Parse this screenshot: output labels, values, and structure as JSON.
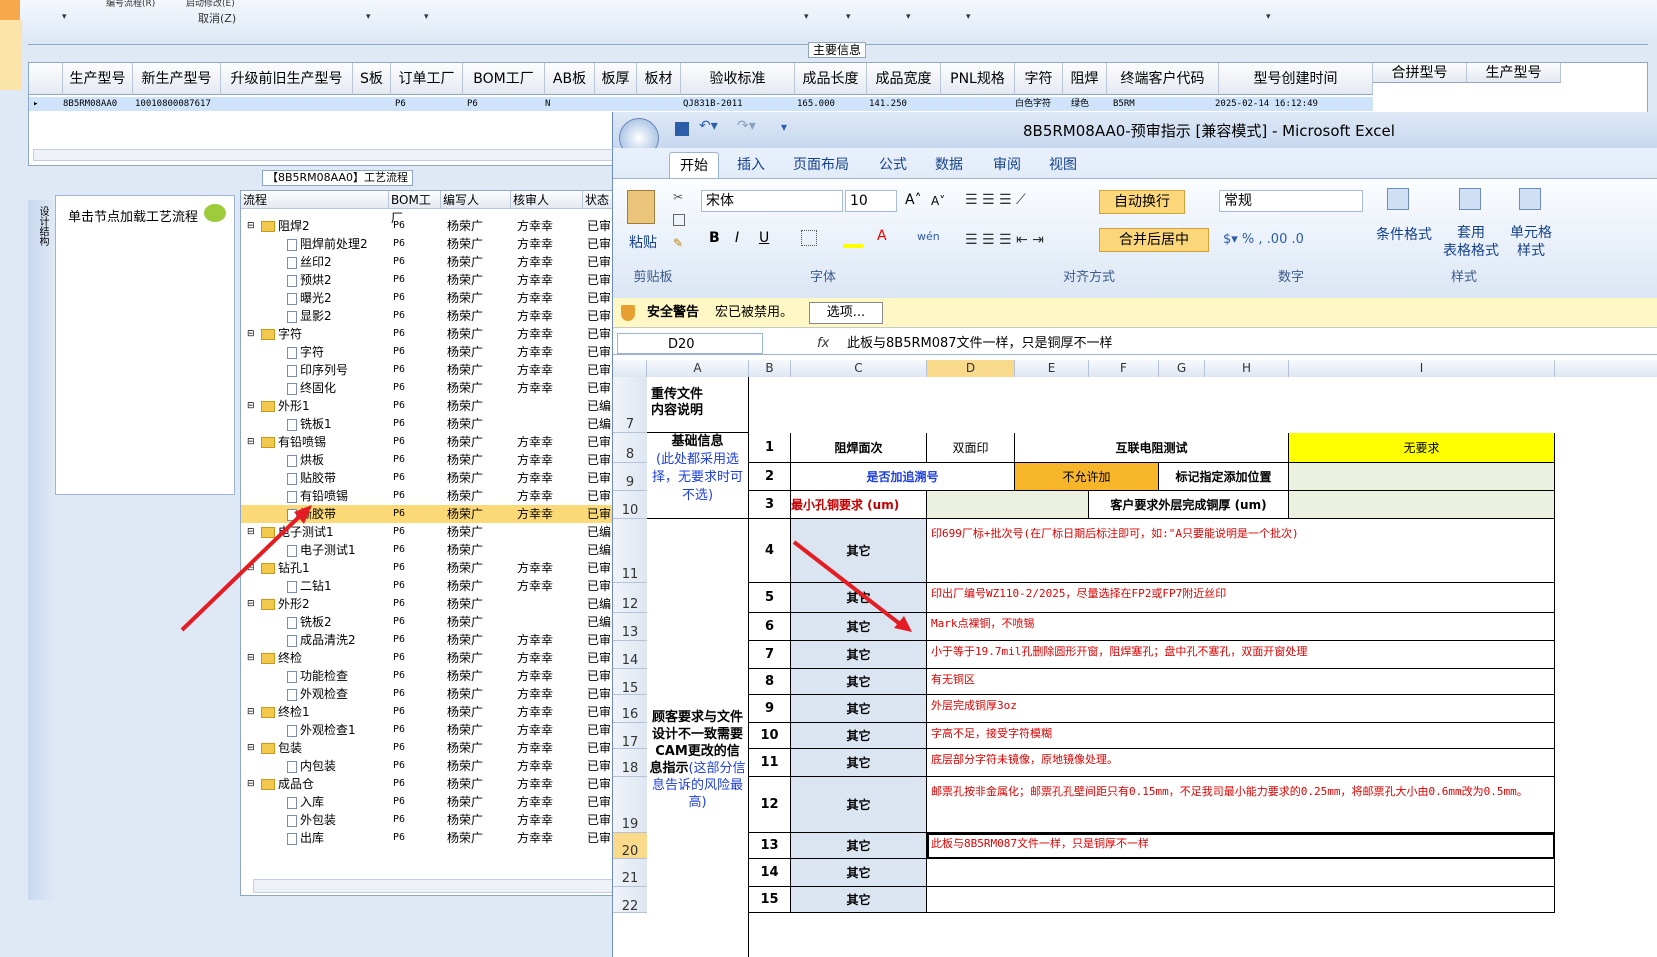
{
  "toolbar": {
    "item1": "编号流程(R)",
    "item2": "启动修改(E)",
    "cancel": "取消(Z)"
  },
  "main_info": {
    "title": "主要信息",
    "columns": [
      "生产型号",
      "新生产型号",
      "升级前旧生产型号",
      "S板",
      "订单工厂",
      "BOM工厂",
      "AB板",
      "板厚",
      "板材",
      "验收标准",
      "成品长度",
      "成品宽度",
      "PNL规格",
      "字符",
      "阻焊",
      "终端客户代码",
      "型号创建时间"
    ],
    "extra_columns": [
      "合拼型号",
      "生产型号"
    ],
    "row": [
      "8B5RM08AA0",
      "10010800087617",
      "",
      "",
      "P6",
      "",
      "P6",
      "",
      "N",
      "",
      "QJ831B-2011",
      "165.000",
      "141.250",
      "",
      "白色字符",
      "绿色",
      "B5RM",
      "2025-02-14 16:12:49"
    ]
  },
  "process": {
    "title": "【8B5RM08AA0】工艺流程",
    "left_tab": "设计结构",
    "load_hint": "单击节点加载工艺流程",
    "headers": [
      "流程",
      "BOM工厂",
      "编写人",
      "核审人",
      "状态"
    ],
    "rows": [
      {
        "name": "阻焊2",
        "type": "folder",
        "level": 1,
        "bom": "P6",
        "writer": "杨荣广",
        "reviewer": "方幸幸",
        "status": "已审"
      },
      {
        "name": "阻焊前处理2",
        "type": "file",
        "level": 2,
        "bom": "P6",
        "writer": "杨荣广",
        "reviewer": "方幸幸",
        "status": "已审"
      },
      {
        "name": "丝印2",
        "type": "file",
        "level": 2,
        "bom": "P6",
        "writer": "杨荣广",
        "reviewer": "方幸幸",
        "status": "已审"
      },
      {
        "name": "预烘2",
        "type": "file",
        "level": 2,
        "bom": "P6",
        "writer": "杨荣广",
        "reviewer": "方幸幸",
        "status": "已审"
      },
      {
        "name": "曝光2",
        "type": "file",
        "level": 2,
        "bom": "P6",
        "writer": "杨荣广",
        "reviewer": "方幸幸",
        "status": "已审"
      },
      {
        "name": "显影2",
        "type": "file",
        "level": 2,
        "bom": "P6",
        "writer": "杨荣广",
        "reviewer": "方幸幸",
        "status": "已审"
      },
      {
        "name": "字符",
        "type": "folder",
        "level": 1,
        "bom": "P6",
        "writer": "杨荣广",
        "reviewer": "方幸幸",
        "status": "已审"
      },
      {
        "name": "字符",
        "type": "file",
        "level": 2,
        "bom": "P6",
        "writer": "杨荣广",
        "reviewer": "方幸幸",
        "status": "已审"
      },
      {
        "name": "印序列号",
        "type": "file",
        "level": 2,
        "bom": "P6",
        "writer": "杨荣广",
        "reviewer": "方幸幸",
        "status": "已审"
      },
      {
        "name": "终固化",
        "type": "file",
        "level": 2,
        "bom": "P6",
        "writer": "杨荣广",
        "reviewer": "方幸幸",
        "status": "已审"
      },
      {
        "name": "外形1",
        "type": "folder",
        "level": 1,
        "bom": "P6",
        "writer": "杨荣广",
        "reviewer": "",
        "status": "已编"
      },
      {
        "name": "铣板1",
        "type": "file",
        "level": 2,
        "bom": "P6",
        "writer": "杨荣广",
        "reviewer": "",
        "status": "已编"
      },
      {
        "name": "有铅喷锡",
        "type": "folder",
        "level": 1,
        "bom": "P6",
        "writer": "杨荣广",
        "reviewer": "方幸幸",
        "status": "已审"
      },
      {
        "name": "烘板",
        "type": "file",
        "level": 2,
        "bom": "P6",
        "writer": "杨荣广",
        "reviewer": "方幸幸",
        "status": "已审"
      },
      {
        "name": "贴胶带",
        "type": "file",
        "level": 2,
        "bom": "P6",
        "writer": "杨荣广",
        "reviewer": "方幸幸",
        "status": "已审"
      },
      {
        "name": "有铅喷锡",
        "type": "file",
        "level": 2,
        "bom": "P6",
        "writer": "杨荣广",
        "reviewer": "方幸幸",
        "status": "已审"
      },
      {
        "name": "撕胶带",
        "type": "file",
        "level": 2,
        "bom": "P6",
        "writer": "杨荣广",
        "reviewer": "方幸幸",
        "status": "已审",
        "selected": true
      },
      {
        "name": "电子测试1",
        "type": "folder",
        "level": 1,
        "bom": "P6",
        "writer": "杨荣广",
        "reviewer": "",
        "status": "已编"
      },
      {
        "name": "电子测试1",
        "type": "file",
        "level": 2,
        "bom": "P6",
        "writer": "杨荣广",
        "reviewer": "",
        "status": "已编"
      },
      {
        "name": "钻孔1",
        "type": "folder",
        "level": 1,
        "bom": "P6",
        "writer": "杨荣广",
        "reviewer": "方幸幸",
        "status": "已审"
      },
      {
        "name": "二钻1",
        "type": "file",
        "level": 2,
        "bom": "P6",
        "writer": "杨荣广",
        "reviewer": "方幸幸",
        "status": "已审"
      },
      {
        "name": "外形2",
        "type": "folder",
        "level": 1,
        "bom": "P6",
        "writer": "杨荣广",
        "reviewer": "",
        "status": "已编"
      },
      {
        "name": "铣板2",
        "type": "file",
        "level": 2,
        "bom": "P6",
        "writer": "杨荣广",
        "reviewer": "",
        "status": "已编"
      },
      {
        "name": "成品清洗2",
        "type": "file",
        "level": 2,
        "bom": "P6",
        "writer": "杨荣广",
        "reviewer": "方幸幸",
        "status": "已审"
      },
      {
        "name": "终检",
        "type": "folder",
        "level": 1,
        "bom": "P6",
        "writer": "杨荣广",
        "reviewer": "方幸幸",
        "status": "已审"
      },
      {
        "name": "功能检查",
        "type": "file",
        "level": 2,
        "bom": "P6",
        "writer": "杨荣广",
        "reviewer": "方幸幸",
        "status": "已审"
      },
      {
        "name": "外观检查",
        "type": "file",
        "level": 2,
        "bom": "P6",
        "writer": "杨荣广",
        "reviewer": "方幸幸",
        "status": "已审"
      },
      {
        "name": "终检1",
        "type": "folder",
        "level": 1,
        "bom": "P6",
        "writer": "杨荣广",
        "reviewer": "方幸幸",
        "status": "已审"
      },
      {
        "name": "外观检查1",
        "type": "file",
        "level": 2,
        "bom": "P6",
        "writer": "杨荣广",
        "reviewer": "方幸幸",
        "status": "已审"
      },
      {
        "name": "包装",
        "type": "folder",
        "level": 1,
        "bom": "P6",
        "writer": "杨荣广",
        "reviewer": "方幸幸",
        "status": "已审"
      },
      {
        "name": "内包装",
        "type": "file",
        "level": 2,
        "bom": "P6",
        "writer": "杨荣广",
        "reviewer": "方幸幸",
        "status": "已审"
      },
      {
        "name": "成品仓",
        "type": "folder",
        "level": 1,
        "bom": "P6",
        "writer": "杨荣广",
        "reviewer": "方幸幸",
        "status": "已审"
      },
      {
        "name": "入库",
        "type": "file",
        "level": 2,
        "bom": "P6",
        "writer": "杨荣广",
        "reviewer": "方幸幸",
        "status": "已审"
      },
      {
        "name": "外包装",
        "type": "file",
        "level": 2,
        "bom": "P6",
        "writer": "杨荣广",
        "reviewer": "方幸幸",
        "status": "已审"
      },
      {
        "name": "出库",
        "type": "file",
        "level": 2,
        "bom": "P6",
        "writer": "杨荣广",
        "reviewer": "方幸幸",
        "status": "已审"
      }
    ]
  },
  "excel": {
    "title": "8B5RM08AA0-预审指示 [兼容模式] - Microsoft Excel",
    "tabs": [
      "开始",
      "插入",
      "页面布局",
      "公式",
      "数据",
      "审阅",
      "视图"
    ],
    "clipboard": {
      "paste": "粘贴",
      "group": "剪贴板"
    },
    "font": {
      "name": "宋体",
      "size": "10",
      "group": "字体"
    },
    "align": {
      "wrap": "自动换行",
      "merge": "合并后居中",
      "group": "对齐方式"
    },
    "number": {
      "format": "常规",
      "group": "数字"
    },
    "styles": {
      "cond": "条件格式",
      "table": "套用\n表格格式",
      "cell": "单元格\n样式",
      "group": "样式"
    },
    "security": {
      "label": "安全警告",
      "message": "宏已被禁用。",
      "button": "选项..."
    },
    "namebox": "D20",
    "formula": "此板与8B5RM087文件一样，只是铜厚不一样",
    "columns": [
      "A",
      "B",
      "C",
      "D",
      "E",
      "F",
      "G",
      "H",
      "I"
    ],
    "row_numbers": [
      "7",
      "8",
      "9",
      "10",
      "11",
      "12",
      "13",
      "14",
      "15",
      "16",
      "17",
      "18",
      "19",
      "20",
      "21",
      "22"
    ],
    "cells": {
      "a7": "重传文件\n内容说明",
      "a8": "基础信息",
      "a8_note": "(此处都采用选择，无要求时可不选)",
      "n1": "1",
      "n2": "2",
      "n3": "3",
      "r1c": "阻焊面次",
      "r1d": "双面印",
      "r1e": "互联电阻测试",
      "r1i": "无要求",
      "r2c": "是否加追溯号",
      "r2e": "不允许加",
      "r2g": "标记指定添加位置",
      "r3c": "最小孔铜要求 (um)",
      "r3f": "客户要求外层完成铜厚 (um)",
      "a_main": "顾客要求与文件设计不一致需要CAM更改的信息指示",
      "a_main_note": "(这部分信息告诉的风险最高)",
      "other": "其它"
    },
    "rows": [
      {
        "n": "4",
        "text": "印699厂标+批次号(在厂标日期后标注即可，如:\"A只要能说明是一个批次)"
      },
      {
        "n": "5",
        "text": "印出厂编号WZ110-2/2025，尽量选择在FP2或FP7附近丝印"
      },
      {
        "n": "6",
        "text": "Mark点裸铜，不喷锡"
      },
      {
        "n": "7",
        "text": "小于等于19.7mil孔删除圆形开窗，阻焊塞孔；盘中孔不塞孔，双面开窗处理"
      },
      {
        "n": "8",
        "text": "有无铜区"
      },
      {
        "n": "9",
        "text": "外层完成铜厚3oz"
      },
      {
        "n": "10",
        "text": "字高不足，接受字符模糊"
      },
      {
        "n": "11",
        "text": "底层部分字符未镜像，原地镜像处理。"
      },
      {
        "n": "12",
        "text": "邮票孔按非金属化；邮票孔孔壁间距只有0.15mm，不足我司最小能力要求的0.25mm，将邮票孔大小由0.6mm改为0.5mm。"
      },
      {
        "n": "13",
        "text": "此板与8B5RM087文件一样，只是铜厚不一样"
      },
      {
        "n": "14",
        "text": ""
      },
      {
        "n": "15",
        "text": ""
      }
    ]
  }
}
